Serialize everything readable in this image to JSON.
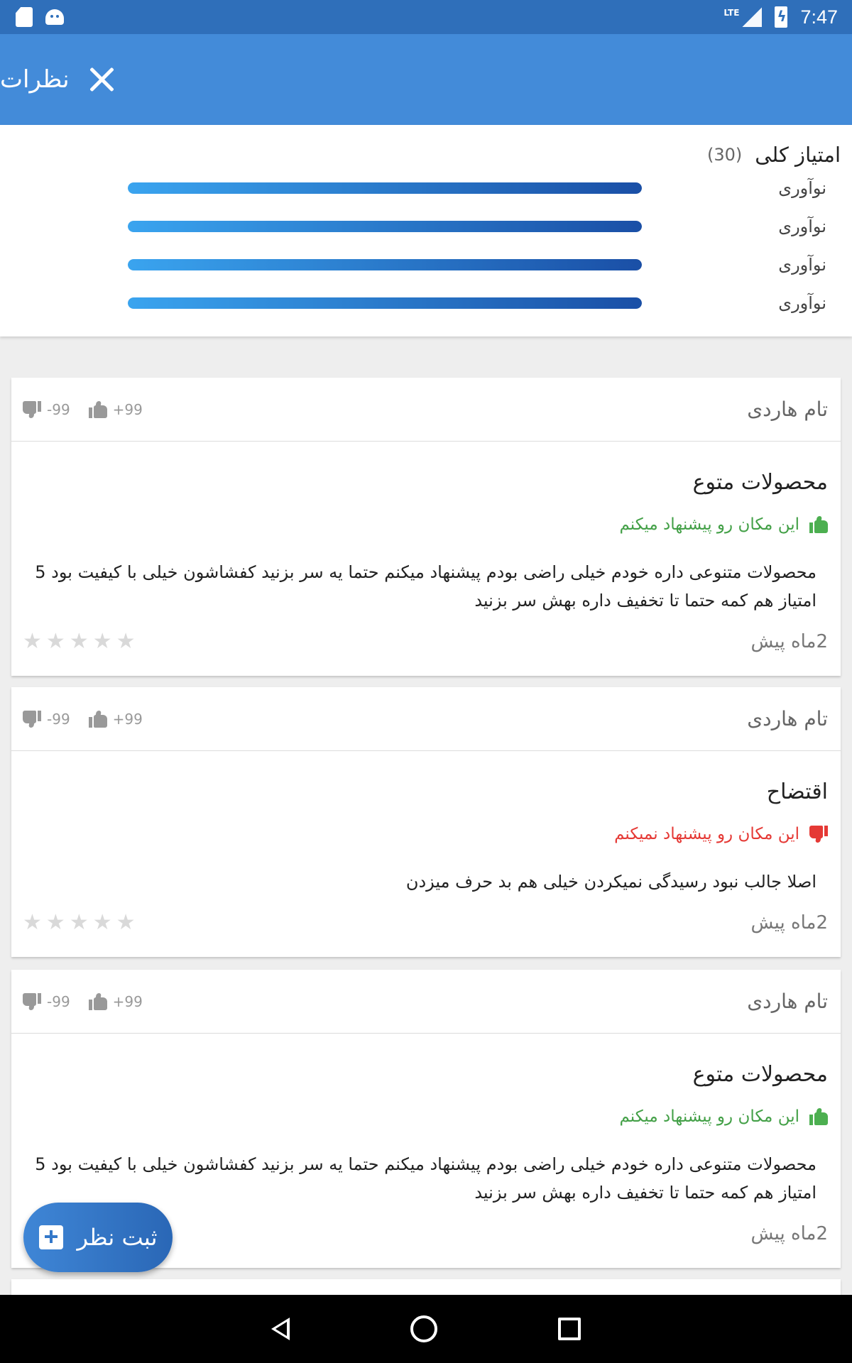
{
  "status_bar": {
    "time": "7:47",
    "network": "LTE",
    "icons": [
      "sd-card-icon",
      "android-icon",
      "signal-icon",
      "battery-charging-icon"
    ]
  },
  "app_bar": {
    "title": "نظرات",
    "close_icon": "close-icon"
  },
  "ratings": {
    "title": "امتیاز کلی",
    "count": "(30)",
    "rows": [
      {
        "label": "نوآوری",
        "fraction": 1.0
      },
      {
        "label": "نوآوری",
        "fraction": 1.0
      },
      {
        "label": "نوآوری",
        "fraction": 1.0
      },
      {
        "label": "نوآوری",
        "fraction": 1.0
      }
    ]
  },
  "reviews": [
    {
      "author": "تام هاردی",
      "likes": "+99",
      "dislikes": "-99",
      "title": "محصولات متوع",
      "recommend_text": "این مکان رو پیشنهاد میکنم",
      "recommended": true,
      "text": "محصولات متنوعی داره خودم خیلی راضی بودم پیشنهاد میکنم حتما یه سر بزنید کفشاشون خیلی با کیفیت بود 5 امتیاز هم کمه حتما تا تخفیف داره بهش سر بزنید",
      "time": "2ماه پیش",
      "stars": 0
    },
    {
      "author": "تام هاردی",
      "likes": "+99",
      "dislikes": "-99",
      "title": "اقتضاح",
      "recommend_text": "این مکان رو پیشنهاد نمیکنم",
      "recommended": false,
      "text": "اصلا جالب نبود رسیدگی نمیکردن خیلی هم بد حرف میزدن",
      "time": "2ماه پیش",
      "stars": 0
    },
    {
      "author": "تام هاردی",
      "likes": "+99",
      "dislikes": "-99",
      "title": "محصولات متوع",
      "recommend_text": "این مکان رو پیشنهاد میکنم",
      "recommended": true,
      "text": "محصولات متنوعی داره خودم خیلی راضی بودم پیشنهاد میکنم حتما یه سر بزنید کفشاشون خیلی با کیفیت بود 5 امتیاز هم کمه حتما تا تخفیف داره بهش سر بزنید",
      "time": "2ماه پیش",
      "stars": 0
    }
  ],
  "fab": {
    "label": "ثبت نظر",
    "icon": "add-comment-icon"
  },
  "nav_bar": {
    "icons": [
      "back-icon",
      "home-icon",
      "recents-icon"
    ]
  },
  "colors": {
    "status_bar": "#2f6fba",
    "app_bar": "#438bd9",
    "bar_gradient_start": "#3aa4ef",
    "bar_gradient_end": "#1a4fa6",
    "recommend_positive": "#43a047",
    "recommend_negative": "#e53935"
  }
}
